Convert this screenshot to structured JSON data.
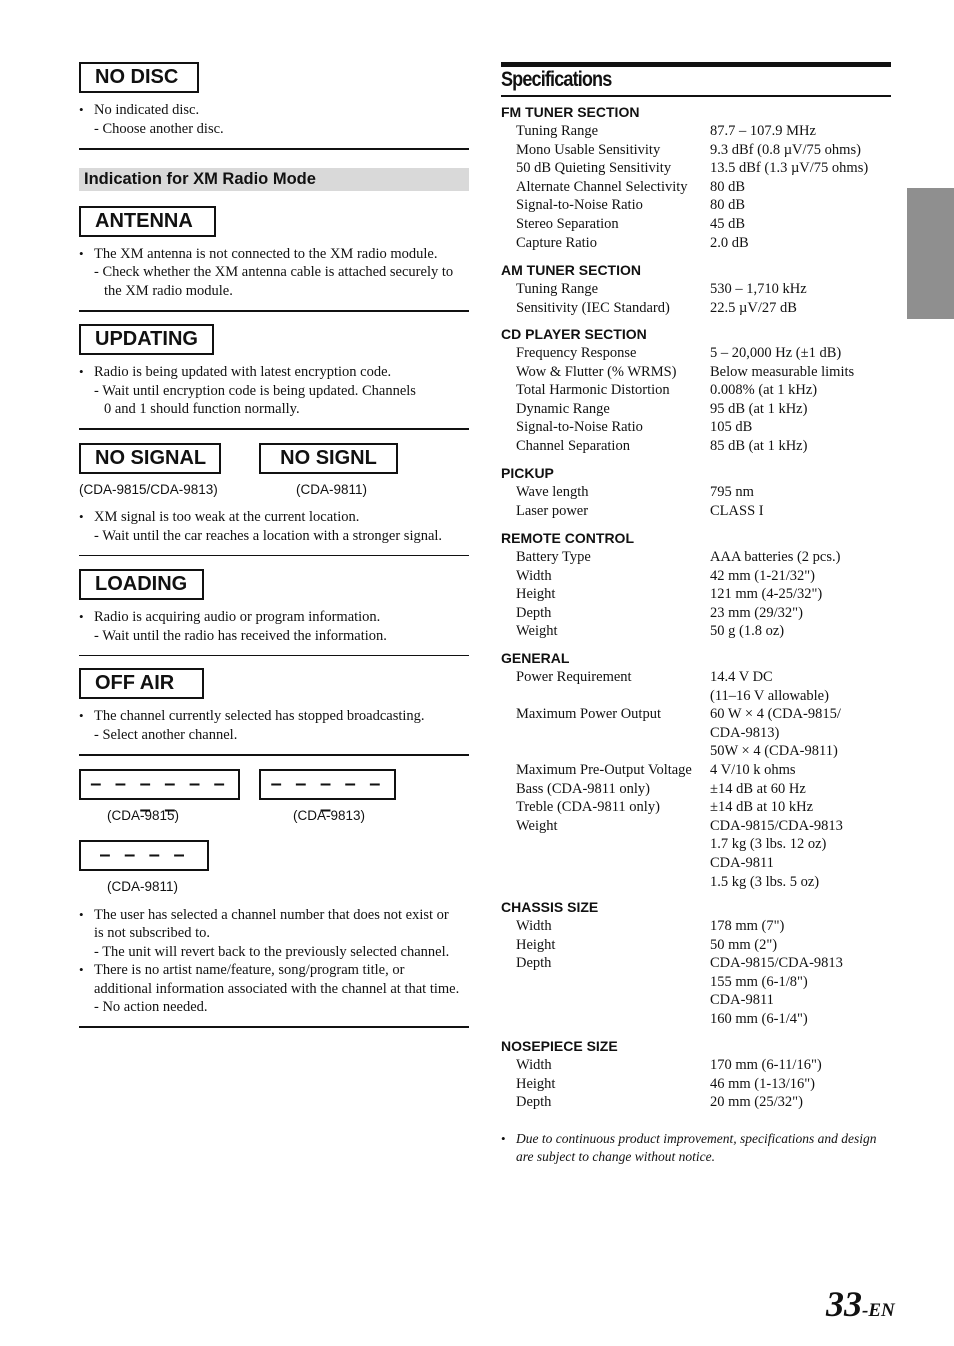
{
  "left": {
    "no_disc": {
      "label": "NO DISC",
      "bullet": "No indicated disc.",
      "action": "- Choose another disc."
    },
    "xm_heading": "Indication for XM Radio Mode",
    "antenna": {
      "label": "ANTENNA",
      "bullet": "The XM antenna is not connected to the XM radio module.",
      "action_1": "- Check whether the XM antenna cable is attached securely to",
      "action_2": "the XM radio module."
    },
    "updating": {
      "label": "UPDATING",
      "bullet": "Radio is being updated with latest encryption code.",
      "action_1": "- Wait until encryption code is being updated. Channels",
      "action_2": "0 and 1 should function normally."
    },
    "no_signal": {
      "label_a": "NO SIGNAL",
      "label_b": "NO SIGNL",
      "model_a": "(CDA-9815/CDA-9813)",
      "model_b": "(CDA-9811)",
      "bullet": "XM signal is too weak at the current location.",
      "action": "- Wait until the car reaches a location with a stronger signal."
    },
    "loading": {
      "label": "LOADING",
      "bullet": "Radio is acquiring audio or program information.",
      "action": "- Wait until the radio has received the information."
    },
    "off_air": {
      "label": "OFF AIR",
      "bullet": "The channel currently selected has stopped broadcasting.",
      "action": "- Select another channel."
    },
    "dashes": {
      "display_a": "– – – – – – – –",
      "display_b": "– – – – – –",
      "display_c": "– – – –",
      "model_a": "(CDA-9815)",
      "model_b": "(CDA-9813)",
      "model_c": "(CDA-9811)",
      "bullet_1_line_1": "The user has selected a channel number that does not exist or",
      "bullet_1_line_2": "is not subscribed to.",
      "action_1": "- The unit will revert back to the previously selected channel.",
      "bullet_2_line_1": "There is no artist name/feature, song/program title, or",
      "bullet_2_line_2": "additional information associated with the channel at that time.",
      "action_2": "- No action needed."
    },
    "bullet_char": "•"
  },
  "specs": {
    "title": "Specifications",
    "sections": [
      {
        "heading": "FM TUNER SECTION",
        "rows": [
          [
            "Tuning Range",
            "87.7 – 107.9 MHz"
          ],
          [
            "Mono Usable Sensitivity",
            "9.3 dBf (0.8 µV/75 ohms)"
          ],
          [
            "50 dB Quieting Sensitivity",
            "13.5 dBf (1.3 µV/75 ohms)"
          ],
          [
            "Alternate Channel Selectivity",
            "80 dB"
          ],
          [
            "Signal-to-Noise Ratio",
            "80 dB"
          ],
          [
            "Stereo Separation",
            "45 dB"
          ],
          [
            "Capture Ratio",
            "2.0 dB"
          ]
        ]
      },
      {
        "heading": "AM TUNER SECTION",
        "rows": [
          [
            "Tuning Range",
            "530 – 1,710 kHz"
          ],
          [
            "Sensitivity (IEC Standard)",
            "22.5 µV/27 dB"
          ]
        ]
      },
      {
        "heading": "CD PLAYER SECTION",
        "rows": [
          [
            "Frequency Response",
            "5 – 20,000 Hz (±1 dB)"
          ],
          [
            "Wow & Flutter (% WRMS)",
            "Below measurable limits"
          ],
          [
            "Total Harmonic Distortion",
            "0.008% (at 1 kHz)"
          ],
          [
            "Dynamic Range",
            "95 dB (at 1 kHz)"
          ],
          [
            "Signal-to-Noise Ratio",
            "105 dB"
          ],
          [
            "Channel Separation",
            "85 dB (at 1 kHz)"
          ]
        ]
      },
      {
        "heading": "PICKUP",
        "rows": [
          [
            "Wave length",
            "795 nm"
          ],
          [
            "Laser power",
            "CLASS I"
          ]
        ]
      },
      {
        "heading": "REMOTE CONTROL",
        "rows": [
          [
            "Battery Type",
            "AAA batteries (2 pcs.)"
          ],
          [
            "Width",
            "42 mm (1-21/32\")"
          ],
          [
            "Height",
            "121 mm (4-25/32\")"
          ],
          [
            "Depth",
            "23 mm (29/32\")"
          ],
          [
            "Weight",
            "50 g (1.8 oz)"
          ]
        ]
      },
      {
        "heading": "GENERAL",
        "rows": [
          [
            "Power Requirement",
            "14.4 V DC"
          ],
          [
            "",
            " (11–16 V allowable)"
          ],
          [
            "Maximum Power Output",
            "60 W × 4 (CDA-9815/"
          ],
          [
            "",
            "CDA-9813)"
          ],
          [
            "",
            "50W × 4 (CDA-9811)"
          ],
          [
            "Maximum Pre-Output Voltage",
            "4 V/10 k ohms"
          ],
          [
            "Bass (CDA-9811 only)",
            "±14 dB at 60 Hz"
          ],
          [
            "Treble (CDA-9811 only)",
            "±14 dB at 10 kHz"
          ],
          [
            "Weight",
            "CDA-9815/CDA-9813"
          ],
          [
            "",
            "1.7 kg (3 lbs. 12 oz)"
          ],
          [
            "",
            "CDA-9811"
          ],
          [
            "",
            "1.5 kg (3 lbs. 5 oz)"
          ]
        ]
      },
      {
        "heading": "CHASSIS SIZE",
        "rows": [
          [
            "Width",
            "178 mm (7\")"
          ],
          [
            "Height",
            "50 mm (2\")"
          ],
          [
            "Depth",
            "CDA-9815/CDA-9813"
          ],
          [
            "",
            "155 mm (6-1/8\")"
          ],
          [
            "",
            "CDA-9811"
          ],
          [
            "",
            "160 mm (6-1/4\")"
          ]
        ]
      },
      {
        "heading": "NOSEPIECE SIZE",
        "rows": [
          [
            "Width",
            "170 mm (6-11/16\")"
          ],
          [
            "Height",
            "46 mm (1-13/16\")"
          ],
          [
            "Depth",
            "20 mm (25/32\")"
          ]
        ]
      }
    ],
    "note_line_1": "Due to continuous product improvement, specifications and design",
    "note_line_2": "are subject to change without notice."
  },
  "footer": {
    "page_number": "33",
    "page_suffix": "-EN"
  },
  "colors": {
    "side_tab": "#8f8f8f",
    "xm_heading_bg": "#d9d9d9",
    "text": "#111111"
  }
}
